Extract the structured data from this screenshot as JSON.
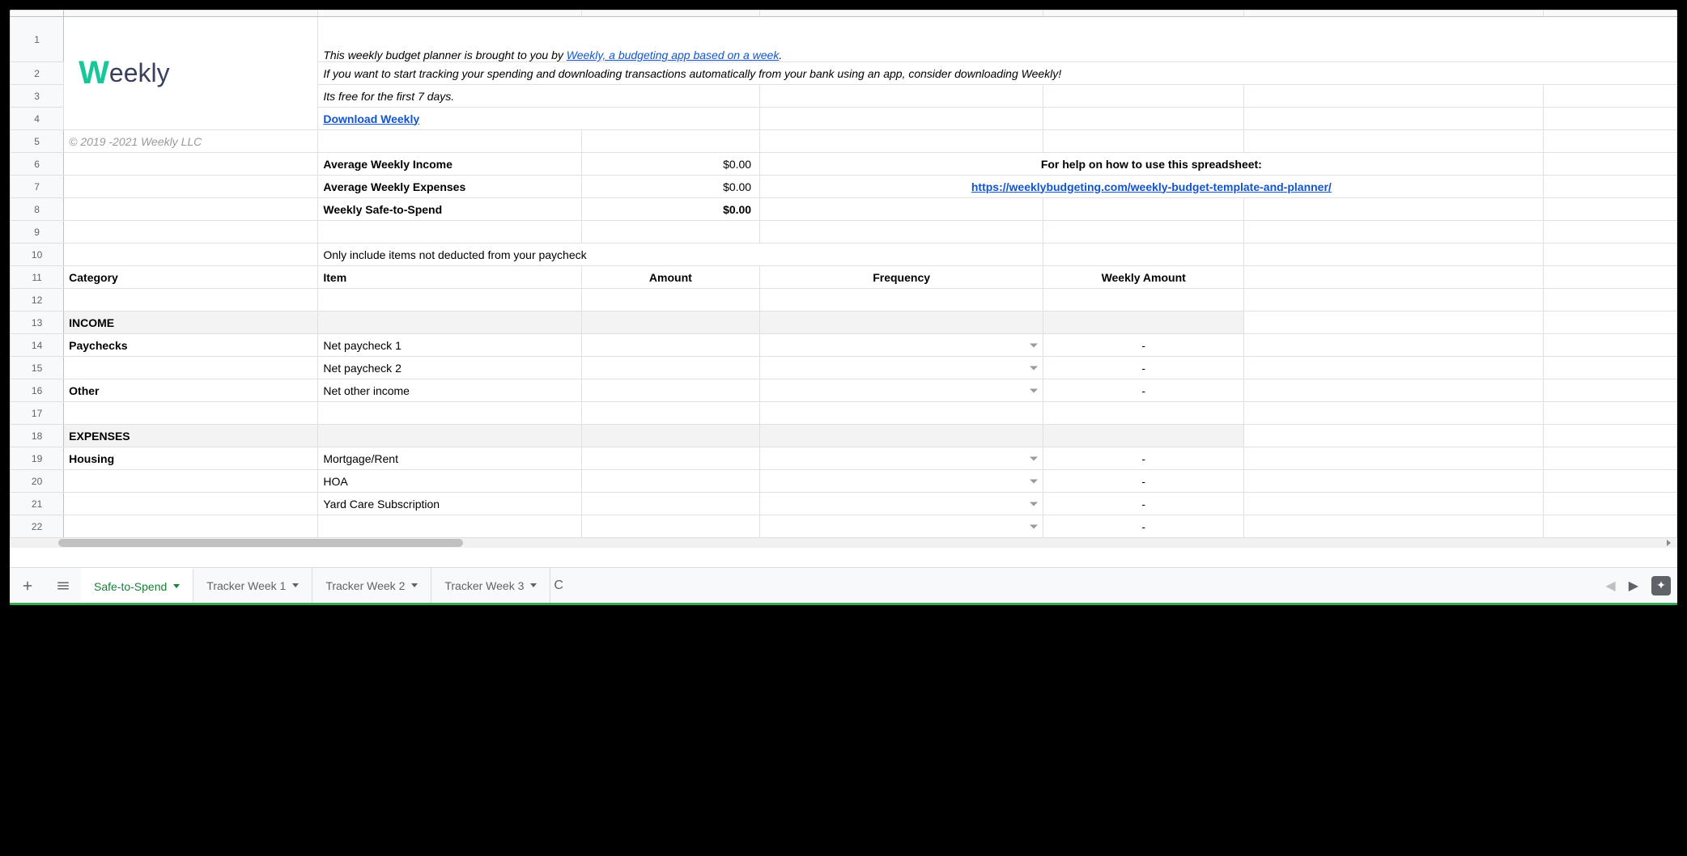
{
  "logo": {
    "w": "W",
    "rest": "eekly"
  },
  "intro": {
    "line1_pre": "This weekly budget planner is brought to you by ",
    "line1_link": "Weekly, a budgeting app based on a week",
    "line1_post": ".",
    "line2": "If you want to start tracking your spending and downloading transactions automatically from your bank using an app, consider downloading Weekly!",
    "line3": "Its free for the first 7 days.",
    "download_label": "Download Weekly",
    "copyright": "© 2019 -2021 Weekly LLC"
  },
  "summary": {
    "avg_income_label": "Average Weekly Income",
    "avg_income_value": "$0.00",
    "avg_expenses_label": "Average Weekly Expenses",
    "avg_expenses_value": "$0.00",
    "safe_label": "Weekly Safe-to-Spend",
    "safe_value": "$0.00",
    "help_label": "For help on how to use this spreadsheet:",
    "help_link": "https://weeklybudgeting.com/weekly-budget-template-and-planner/"
  },
  "note": "Only include items not deducted from your paycheck",
  "headers": {
    "category": "Category",
    "item": "Item",
    "amount": "Amount",
    "frequency": "Frequency",
    "weekly_amount": "Weekly Amount"
  },
  "sections": {
    "income": "INCOME",
    "expenses": "EXPENSES"
  },
  "rows": {
    "paychecks_label": "Paychecks",
    "np1": "Net paycheck 1",
    "np2": "Net paycheck 2",
    "other_label": "Other",
    "other_item": "Net other income",
    "housing_label": "Housing",
    "mort": "Mortgage/Rent",
    "hoa": "HOA",
    "yard": "Yard Care Subscription",
    "dash": "-"
  },
  "row_numbers": [
    "1",
    "2",
    "3",
    "4",
    "5",
    "6",
    "7",
    "8",
    "9",
    "10",
    "11",
    "12",
    "13",
    "14",
    "15",
    "16",
    "17",
    "18",
    "19",
    "20",
    "21",
    "22"
  ],
  "tabs": {
    "active": "Safe-to-Spend",
    "t2": "Tracker Week 1",
    "t3": "Tracker Week 2",
    "t4": "Tracker Week 3",
    "partial": "C"
  }
}
